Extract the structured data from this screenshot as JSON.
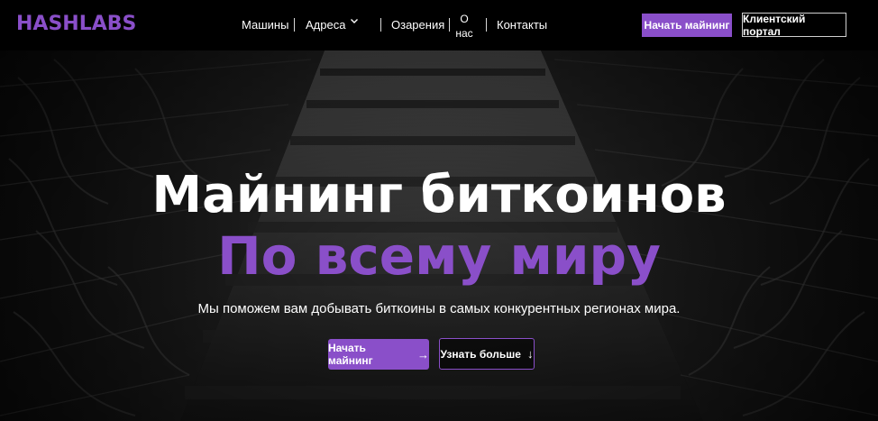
{
  "brand": {
    "logo_text": "HASHLABS",
    "accent_color": "#8a4fc9"
  },
  "nav": {
    "items": [
      {
        "label": "Машины"
      },
      {
        "label": "Адреса",
        "icon": "chevron-down-icon"
      },
      {
        "label": "Озарения"
      },
      {
        "label_line1": "О",
        "label_line2": "нас"
      },
      {
        "label": "Контакты"
      }
    ],
    "start_mining_label": "Начать майнинг",
    "client_portal_label": "Клиентский портал"
  },
  "hero": {
    "title_line1": "Майнинг биткоинов",
    "title_line2": "По всему миру",
    "subtitle": "Мы поможем вам добывать биткоины в самых конкурентных регионах мира.",
    "primary_button": {
      "label": "Начать майнинг",
      "icon": "arrow-right-icon",
      "glyph": "→"
    },
    "secondary_button": {
      "label": "Узнать больше",
      "icon": "arrow-down-icon",
      "glyph": "↓"
    },
    "background": "server-rack-photo"
  }
}
